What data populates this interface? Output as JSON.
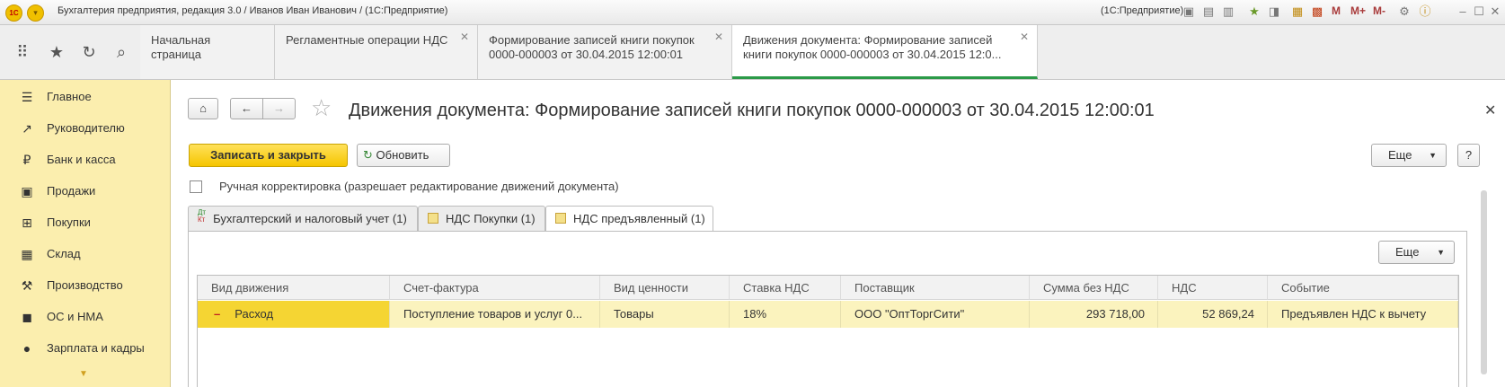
{
  "titlebar": {
    "title": "Бухгалтерия предприятия, редакция 3.0 / Иванов Иван Иванович / (1С:Предприятие)",
    "right_label": "(1С:Предприятие)",
    "logo_text": "1С",
    "m_buttons": [
      "M",
      "M+",
      "M-"
    ]
  },
  "tabs": [
    {
      "label": "Начальная страница"
    },
    {
      "label": "Регламентные операции НДС"
    },
    {
      "label": "Формирование записей книги покупок 0000-000003 от 30.04.2015 12:00:01"
    },
    {
      "label": "Движения документа: Формирование записей книги покупок 0000-000003 от 30.04.2015 12:0..."
    }
  ],
  "sidebar": {
    "items": [
      {
        "label": "Главное",
        "icon": "menu-lines-icon"
      },
      {
        "label": "Руководителю",
        "icon": "trend-icon"
      },
      {
        "label": "Банк и касса",
        "icon": "ruble-icon"
      },
      {
        "label": "Продажи",
        "icon": "bag-icon"
      },
      {
        "label": "Покупки",
        "icon": "cart-icon"
      },
      {
        "label": "Склад",
        "icon": "warehouse-icon"
      },
      {
        "label": "Производство",
        "icon": "factory-icon"
      },
      {
        "label": "ОС и НМА",
        "icon": "truck-icon"
      },
      {
        "label": "Зарплата и кадры",
        "icon": "person-icon"
      }
    ]
  },
  "document": {
    "title": "Движения документа: Формирование записей книги покупок 0000-000003 от 30.04.2015 12:00:01",
    "save_close": "Записать и закрыть",
    "refresh": "Обновить",
    "more": "Еще",
    "help": "?",
    "manual_label": "Ручная корректировка (разрешает редактирование движений документа)",
    "manual_checked": false
  },
  "doc_tabs": [
    {
      "label": "Бухгалтерский и налоговый учет (1)",
      "icon": "dt-kt-icon"
    },
    {
      "label": "НДС Покупки (1)",
      "icon": "register-icon"
    },
    {
      "label": "НДС предъявленный (1)",
      "icon": "register-icon"
    }
  ],
  "panel": {
    "more": "Еще"
  },
  "table": {
    "columns": [
      "Вид движения",
      "Счет-фактура",
      "Вид ценности",
      "Ставка НДС",
      "Поставщик",
      "Сумма без НДС",
      "НДС",
      "Событие"
    ],
    "rows": [
      {
        "movement": "Расход",
        "invoice": "Поступление товаров и услуг 0...",
        "value_type": "Товары",
        "rate": "18%",
        "supplier": "ООО \"ОптТоргСити\"",
        "amount": "293 718,00",
        "vat": "52 869,24",
        "event": "Предъявлен НДС к вычету"
      }
    ]
  },
  "colors": {
    "accent_yellow": "#f5c500",
    "sidebar_bg": "#fbeeae",
    "active_tab_line": "#2b9a48",
    "row_bg": "#fbf3be"
  }
}
